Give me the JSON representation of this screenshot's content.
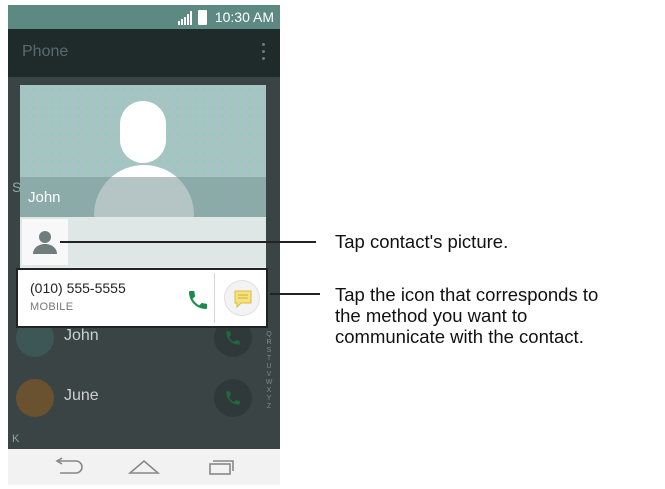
{
  "status_bar": {
    "time": "10:30 AM"
  },
  "app_bar": {
    "title": "Phone"
  },
  "background_list": {
    "section_letter": "S",
    "rows": [
      {
        "name": "John"
      },
      {
        "name": "June"
      }
    ],
    "section_k": "K",
    "alphabet": [
      "Q",
      "R",
      "S",
      "T",
      "U",
      "V",
      "W",
      "X",
      "Y",
      "Z"
    ]
  },
  "dialog": {
    "contact_name": "John",
    "phone_number": "(010) 555-5555",
    "phone_type": "MOBILE"
  },
  "callouts": {
    "picture": "Tap contact's picture.",
    "icon_line1": "Tap the icon that corresponds to",
    "icon_line2": "the method you want to",
    "icon_line3": "communicate with the contact."
  },
  "colors": {
    "status_bar": "#5c8a82",
    "call_green": "#1e8a4a",
    "message_yellow": "#f5e27a"
  }
}
